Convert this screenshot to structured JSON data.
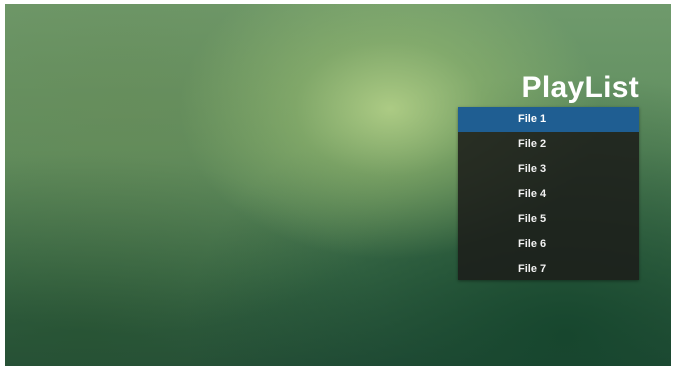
{
  "playlist": {
    "title": "PlayList",
    "selected_index": 0,
    "selected_color": "#1f5e92",
    "items": [
      {
        "label": "File 1"
      },
      {
        "label": "File 2"
      },
      {
        "label": "File 3"
      },
      {
        "label": "File 4"
      },
      {
        "label": "File 5"
      },
      {
        "label": "File 6"
      },
      {
        "label": "File 7"
      }
    ]
  }
}
